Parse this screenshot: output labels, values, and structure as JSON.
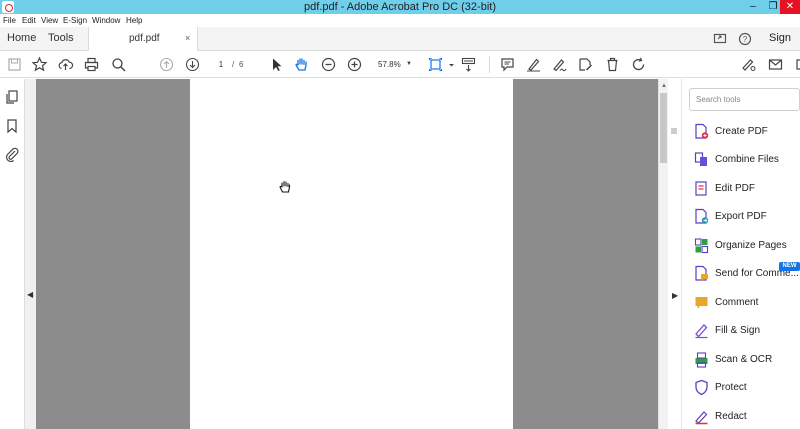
{
  "window": {
    "title": "pdf.pdf - Adobe Acrobat Pro DC (32-bit)",
    "minimize": "–",
    "maximize": "❐",
    "close": "✕"
  },
  "menu": [
    "File",
    "Edit",
    "View",
    "E-Sign",
    "Window",
    "Help"
  ],
  "tabs": {
    "home": "Home",
    "tools": "Tools",
    "document": "pdf.pdf",
    "close": "×",
    "signin": "Sign In"
  },
  "toolbar": {
    "page_current": "1",
    "page_sep": "/",
    "page_total": "6",
    "zoom": "57.8%",
    "zoom_caret": "▼"
  },
  "scroll": {
    "up": "▲"
  },
  "panes": {
    "left_collapse": "◀",
    "right_collapse": "▶"
  },
  "search": {
    "placeholder": "Search tools"
  },
  "tools_list": [
    {
      "label": "Create PDF",
      "icon": "create-pdf-icon",
      "color": "#e2343f"
    },
    {
      "label": "Combine Files",
      "icon": "combine-files-icon",
      "color": "#6b4dd6"
    },
    {
      "label": "Edit PDF",
      "icon": "edit-pdf-icon",
      "color": "#e2343f"
    },
    {
      "label": "Export PDF",
      "icon": "export-pdf-icon",
      "color": "#1a9bb5"
    },
    {
      "label": "Organize Pages",
      "icon": "organize-pages-icon",
      "color": "#2e9e43"
    },
    {
      "label": "Send for Comme...",
      "icon": "send-for-comment-icon",
      "color": "#e8a72b"
    },
    {
      "label": "Comment",
      "icon": "comment-icon",
      "color": "#e8a72b"
    },
    {
      "label": "Fill & Sign",
      "icon": "fill-sign-icon",
      "color": "#7b4ed6"
    },
    {
      "label": "Scan & OCR",
      "icon": "scan-ocr-icon",
      "color": "#2e9e43"
    },
    {
      "label": "Protect",
      "icon": "protect-icon",
      "color": "#5b3fc7"
    },
    {
      "label": "Redact",
      "icon": "redact-icon",
      "color": "#e2343f"
    }
  ],
  "badges": {
    "new": "NEW"
  },
  "colors": {
    "titlebar": "#6fcfea",
    "close_button": "#e81123",
    "doc_background": "#8c8c8c",
    "accent": "#1473e6"
  }
}
